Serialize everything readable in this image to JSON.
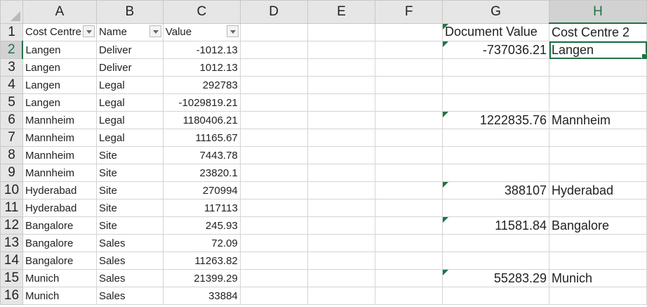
{
  "columns": [
    "A",
    "B",
    "C",
    "D",
    "E",
    "F",
    "G",
    "H"
  ],
  "selected_cell": "H2",
  "accent": "#217346",
  "rows": [
    {
      "n": "1",
      "cells": [
        "Cost Centre",
        "Name",
        "Value",
        "",
        "",
        "",
        "Document Value",
        "Cost Centre 2"
      ]
    },
    {
      "n": "2",
      "cells": [
        "Langen",
        "Deliver",
        "-1012.13",
        "",
        "",
        "",
        "-737036.21",
        "Langen"
      ]
    },
    {
      "n": "3",
      "cells": [
        "Langen",
        "Deliver",
        "1012.13",
        "",
        "",
        "",
        "",
        ""
      ]
    },
    {
      "n": "4",
      "cells": [
        "Langen",
        "Legal",
        "292783",
        "",
        "",
        "",
        "",
        ""
      ]
    },
    {
      "n": "5",
      "cells": [
        "Langen",
        "Legal",
        "-1029819.21",
        "",
        "",
        "",
        "",
        ""
      ]
    },
    {
      "n": "6",
      "cells": [
        "Mannheim",
        "Legal",
        "1180406.21",
        "",
        "",
        "",
        "1222835.76",
        "Mannheim"
      ]
    },
    {
      "n": "7",
      "cells": [
        "Mannheim",
        "Legal",
        "11165.67",
        "",
        "",
        "",
        "",
        ""
      ]
    },
    {
      "n": "8",
      "cells": [
        "Mannheim",
        "Site",
        "7443.78",
        "",
        "",
        "",
        "",
        ""
      ]
    },
    {
      "n": "9",
      "cells": [
        "Mannheim",
        "Site",
        "23820.1",
        "",
        "",
        "",
        "",
        ""
      ]
    },
    {
      "n": "10",
      "cells": [
        "Hyderabad",
        "Site",
        "270994",
        "",
        "",
        "",
        "388107",
        "Hyderabad"
      ]
    },
    {
      "n": "11",
      "cells": [
        "Hyderabad",
        "Site",
        "117113",
        "",
        "",
        "",
        "",
        ""
      ]
    },
    {
      "n": "12",
      "cells": [
        "Bangalore",
        "Site",
        "245.93",
        "",
        "",
        "",
        "11581.84",
        "Bangalore"
      ]
    },
    {
      "n": "13",
      "cells": [
        "Bangalore",
        "Sales",
        "72.09",
        "",
        "",
        "",
        "",
        ""
      ]
    },
    {
      "n": "14",
      "cells": [
        "Bangalore",
        "Sales",
        "11263.82",
        "",
        "",
        "",
        "",
        ""
      ]
    },
    {
      "n": "15",
      "cells": [
        "Munich",
        "Sales",
        "21399.29",
        "",
        "",
        "",
        "55283.29",
        "Munich"
      ]
    },
    {
      "n": "16",
      "cells": [
        "Munich",
        "Sales",
        "33884",
        "",
        "",
        "",
        "",
        ""
      ]
    }
  ]
}
